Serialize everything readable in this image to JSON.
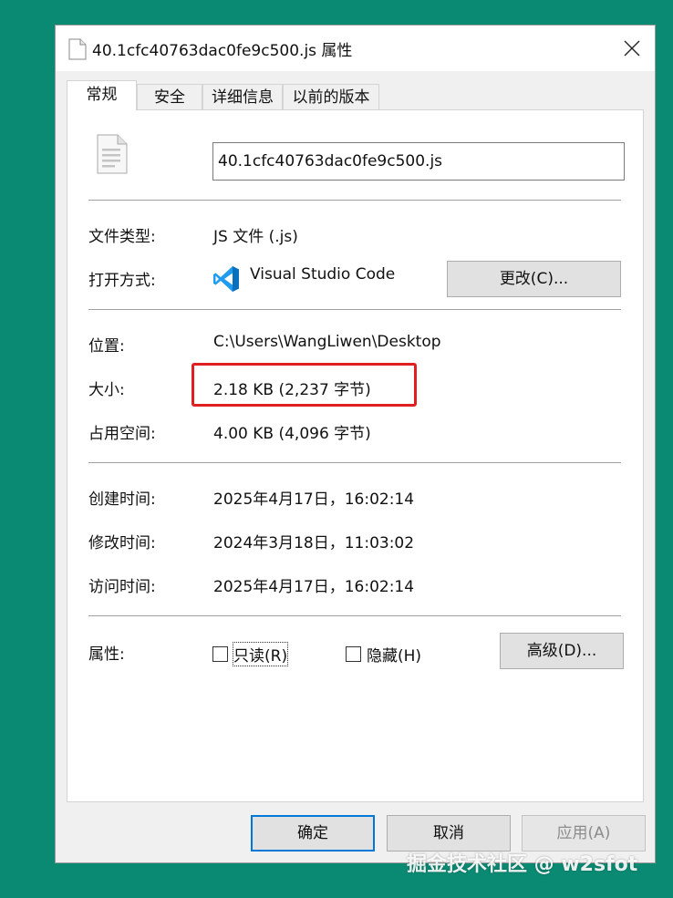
{
  "window": {
    "title": "40.1cfc40763dac0fe9c500.js 属性",
    "close_glyph": "✕"
  },
  "tabs": [
    {
      "label": "常规",
      "active": true
    },
    {
      "label": "安全"
    },
    {
      "label": "详细信息"
    },
    {
      "label": "以前的版本"
    }
  ],
  "general": {
    "file_name": "40.1cfc40763dac0fe9c500.js",
    "file_type_label": "文件类型:",
    "file_type_value": "JS 文件 (.js)",
    "open_with_label": "打开方式:",
    "open_with_app": "Visual Studio Code",
    "change_button": "更改(C)...",
    "location_label": "位置:",
    "location_value": "C:\\Users\\WangLiwen\\Desktop",
    "size_label": "大小:",
    "size_value": "2.18 KB (2,237 字节)",
    "size_on_disk_label": "占用空间:",
    "size_on_disk_value": "4.00 KB (4,096 字节)",
    "created_label": "创建时间:",
    "created_value": "2025年4月17日，16:02:14",
    "modified_label": "修改时间:",
    "modified_value": "2024年3月18日，11:03:02",
    "accessed_label": "访问时间:",
    "accessed_value": "2025年4月17日，16:02:14",
    "attributes_label": "属性:",
    "readonly_label": "只读(R)",
    "hidden_label": "隐藏(H)",
    "advanced_button": "高级(D)..."
  },
  "footer": {
    "ok_button": "确定",
    "cancel_button": "取消",
    "apply_button": "应用(A)"
  },
  "watermark": "掘金技术社区 @ w2sfot",
  "colors": {
    "desktop_bg": "#0b8a73",
    "highlight": "#e02020",
    "focus_border": "#0078d7",
    "vscode_blue": "#0a7acc"
  }
}
